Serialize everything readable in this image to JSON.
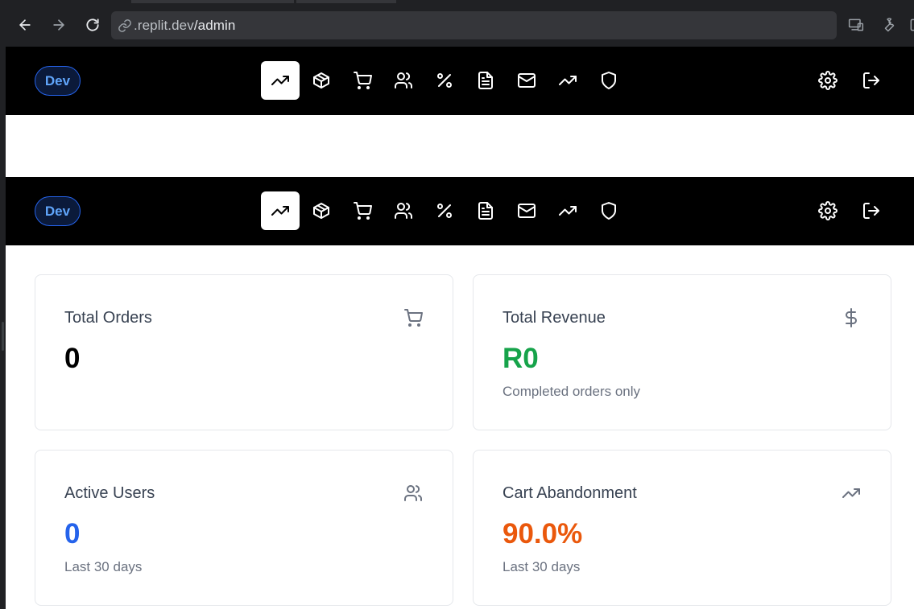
{
  "browser": {
    "url_domain": ".replit.dev",
    "url_path": "/admin"
  },
  "nav": {
    "badge": "Dev",
    "icons": [
      "trending-up-icon",
      "package-icon",
      "shopping-cart-icon",
      "users-icon",
      "percent-icon",
      "file-text-icon",
      "mail-icon",
      "trending-up-icon",
      "shield-icon"
    ],
    "active_index": 0,
    "right_icons": [
      "settings-icon",
      "log-out-icon"
    ]
  },
  "stats": {
    "total_orders": {
      "title": "Total Orders",
      "value": "0",
      "icon": "shopping-cart-icon"
    },
    "total_revenue": {
      "title": "Total Revenue",
      "value": "R0",
      "sub": "Completed orders only",
      "icon": "dollar-sign-icon"
    },
    "active_users": {
      "title": "Active Users",
      "value": "0",
      "sub": "Last 30 days",
      "icon": "users-icon"
    },
    "cart_abandonment": {
      "title": "Cart Abandonment",
      "value": "90.0%",
      "sub": "Last 30 days",
      "icon": "trending-up-icon"
    }
  },
  "colors": {
    "badge_blue": "#60a5fa",
    "revenue_green": "#16a34a",
    "users_blue": "#2563eb",
    "abandonment_orange": "#ea580c"
  }
}
